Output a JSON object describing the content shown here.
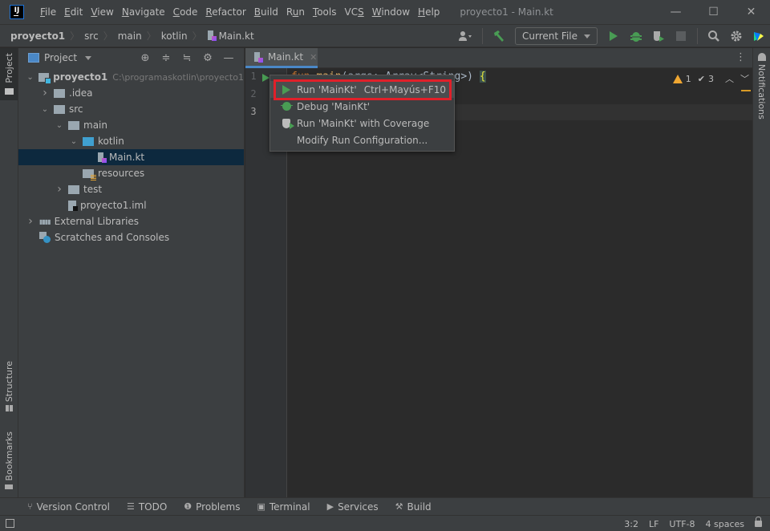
{
  "window": {
    "title": "proyecto1 - Main.kt",
    "logo_text": "IJ",
    "minimize": "—",
    "maximize": "☐",
    "close": "✕"
  },
  "menu": [
    {
      "label": "File",
      "mnemonic": "F"
    },
    {
      "label": "Edit",
      "mnemonic": "E"
    },
    {
      "label": "View",
      "mnemonic": "V"
    },
    {
      "label": "Navigate",
      "mnemonic": "N"
    },
    {
      "label": "Code",
      "mnemonic": "C"
    },
    {
      "label": "Refactor",
      "mnemonic": "R"
    },
    {
      "label": "Build",
      "mnemonic": "B"
    },
    {
      "label": "Run",
      "mnemonic": "u"
    },
    {
      "label": "Tools",
      "mnemonic": "T"
    },
    {
      "label": "VCS",
      "mnemonic": "S"
    },
    {
      "label": "Window",
      "mnemonic": "W"
    },
    {
      "label": "Help",
      "mnemonic": "H"
    }
  ],
  "breadcrumb": [
    "proyecto1",
    "src",
    "main",
    "kotlin",
    "Main.kt"
  ],
  "toolbar": {
    "run_config": "Current File",
    "icons": [
      "user-icon",
      "build-hammer-icon",
      "run-icon",
      "debug-icon",
      "coverage-icon",
      "stop-icon",
      "search-icon",
      "settings-icon",
      "toolbox-icon"
    ]
  },
  "left_stripe": {
    "project": "Project",
    "structure": "Structure",
    "bookmarks": "Bookmarks"
  },
  "project_panel": {
    "title": "Project",
    "tree": [
      {
        "label": "proyecto1",
        "path": "C:\\programaskotlin\\proyecto1",
        "depth": 0,
        "expanded": true,
        "type": "module"
      },
      {
        "label": ".idea",
        "depth": 1,
        "expanded": false,
        "type": "folder"
      },
      {
        "label": "src",
        "depth": 1,
        "expanded": true,
        "type": "folder"
      },
      {
        "label": "main",
        "depth": 2,
        "expanded": true,
        "type": "folder"
      },
      {
        "label": "kotlin",
        "depth": 3,
        "expanded": true,
        "type": "source-folder"
      },
      {
        "label": "Main.kt",
        "depth": 4,
        "type": "kotlin-file",
        "selected": true
      },
      {
        "label": "resources",
        "depth": 3,
        "type": "resources-folder"
      },
      {
        "label": "test",
        "depth": 2,
        "expanded": false,
        "type": "folder"
      },
      {
        "label": "proyecto1.iml",
        "depth": 2,
        "type": "iml-file"
      },
      {
        "label": "External Libraries",
        "depth": 0,
        "expanded": false,
        "type": "libraries"
      },
      {
        "label": "Scratches and Consoles",
        "depth": 0,
        "type": "scratches"
      }
    ]
  },
  "editor": {
    "tab": "Main.kt",
    "line_numbers": [
      "1",
      "2",
      "3"
    ],
    "code_line1": {
      "kw": "fun",
      "fn": "main",
      "rest": "(args: Array<String>) ",
      "brace": "{"
    },
    "warnings": "1",
    "weak_warnings": "3"
  },
  "popup": {
    "items": [
      {
        "label": "Run 'MainKt'",
        "shortcut": "Ctrl+Mayús+F10",
        "icon": "run-icon"
      },
      {
        "label": "Debug 'MainKt'",
        "shortcut": "",
        "icon": "debug-icon"
      },
      {
        "label": "Run 'MainKt' with Coverage",
        "shortcut": "",
        "icon": "coverage-icon"
      },
      {
        "label": "Modify Run Configuration...",
        "shortcut": "",
        "icon": ""
      }
    ]
  },
  "right_stripe": {
    "notifications": "Notifications"
  },
  "bottom_tools": [
    {
      "label": "Version Control",
      "icon": "⑂"
    },
    {
      "label": "TODO",
      "icon": "☰"
    },
    {
      "label": "Problems",
      "icon": "❶"
    },
    {
      "label": "Terminal",
      "icon": "▣"
    },
    {
      "label": "Services",
      "icon": "▶"
    },
    {
      "label": "Build",
      "icon": "⚒"
    }
  ],
  "status": {
    "position": "3:2",
    "line_sep": "LF",
    "encoding": "UTF-8",
    "indent": "4 spaces"
  },
  "colors": {
    "accent_blue": "#4a88c7",
    "run_green": "#499c54",
    "highlight_red": "#e0202a",
    "warning_yellow": "#f0a732"
  }
}
